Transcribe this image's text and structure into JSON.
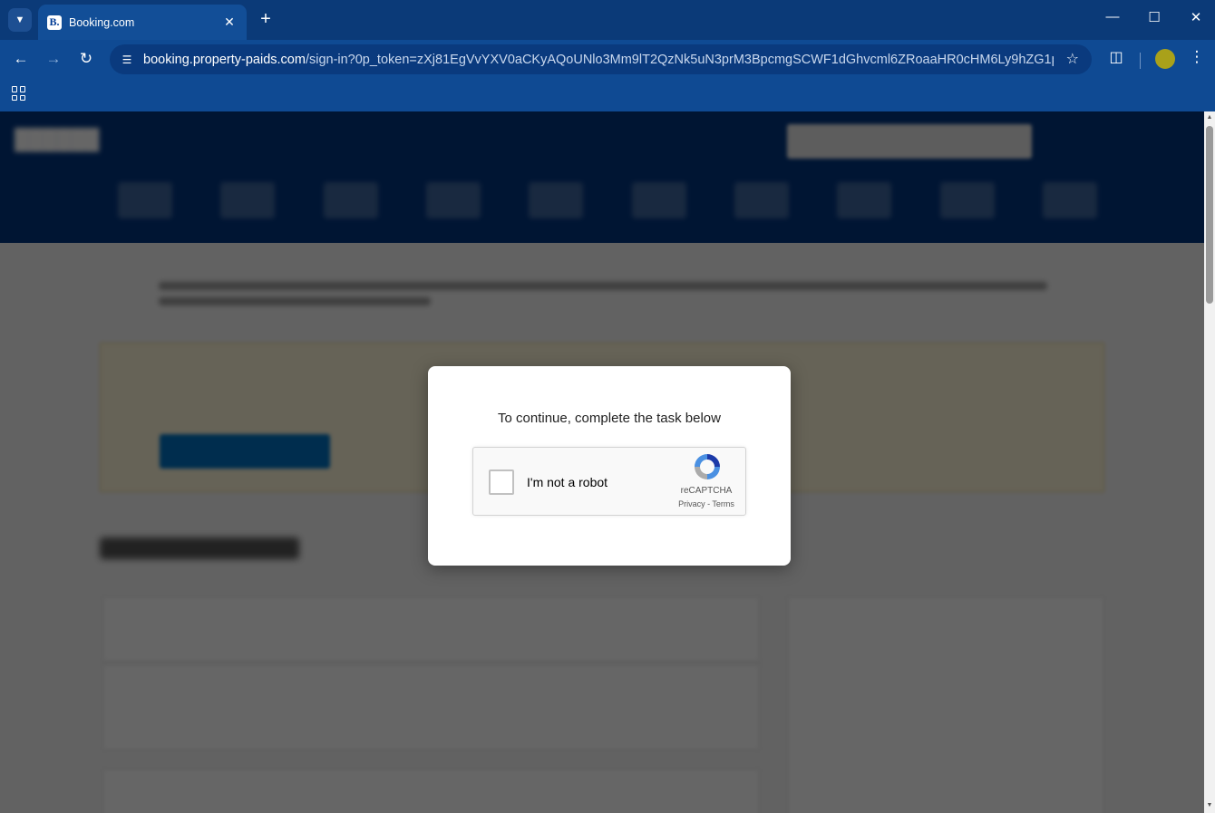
{
  "browser": {
    "tab_title": "Booking.com",
    "tab_favicon_letter": "B.",
    "url_host": "booking.property-paids.com",
    "url_path": "/sign-in?0p_token=zXj81EgVvYXV0aCKyAQoUNlo3Mm9lT2QzNk5uN3prM3BpcmgSCWF1dGhvcml6ZRoaaHR0cHM6Ly9hZG1pbi5ib2...",
    "icons": {
      "tab_search": "chevron-down-icon",
      "tab_close": "close-icon",
      "new_tab": "plus-icon",
      "minimize": "minimize-icon",
      "maximize": "maximize-icon",
      "close_window": "close-icon",
      "back": "arrow-left-icon",
      "forward": "arrow-right-icon",
      "reload": "reload-icon",
      "site_info": "tune-icon",
      "bookmark": "star-icon",
      "extensions": "puzzle-icon",
      "menu": "kebab-menu-icon",
      "apps": "apps-grid-icon"
    },
    "colors": {
      "frame": "#0b3a78",
      "toolbar": "#0f4a93",
      "omnibox": "#0a3a7e"
    }
  },
  "modal": {
    "prompt": "To continue, complete the task below"
  },
  "recaptcha": {
    "checkbox_label": "I'm not a robot",
    "brand": "reCAPTCHA",
    "links": "Privacy - Terms",
    "checked": false
  }
}
